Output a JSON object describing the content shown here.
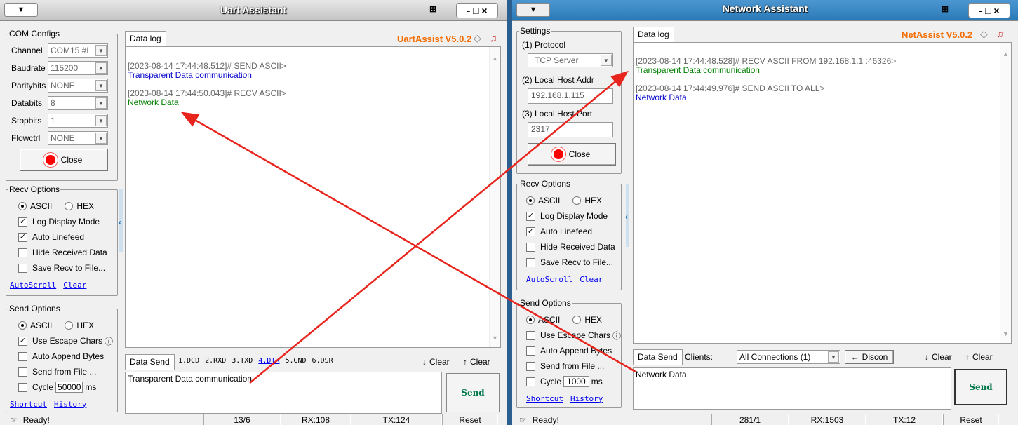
{
  "uart": {
    "title": "Uart Assistant",
    "menu": "▼",
    "window_controls": "- □ ×",
    "com_group": "COM Configs",
    "channel_label": "Channel",
    "channel_value": "COM15 #L",
    "baud_label": "Baudrate",
    "baud_value": "115200",
    "parity_label": "Paritybits",
    "parity_value": "NONE",
    "data_label": "Databits",
    "data_value": "8",
    "stop_label": "Stopbits",
    "stop_value": "1",
    "flow_label": "Flowctrl",
    "flow_value": "NONE",
    "close_label": "Close",
    "recv_group": "Recv Options",
    "ascii": "ASCII",
    "hex": "HEX",
    "log_display": "Log Display Mode",
    "auto_linefeed": "Auto Linefeed",
    "hide_recv": "Hide Received Data",
    "save_recv": "Save Recv to File...",
    "autoscroll": "AutoScroll",
    "clear": "Clear",
    "send_group": "Send Options",
    "escape": "Use Escape Chars",
    "append": "Auto Append Bytes",
    "send_file": "Send from File ...",
    "cycle": "Cycle",
    "cycle_value": "50000",
    "ms": "ms",
    "shortcut": "Shortcut",
    "history": "History",
    "datalog_tab": "Data log",
    "brand": "UartAssist V5.0.2",
    "log": [
      {
        "text": "[2023-08-14 17:44:48.512]# SEND ASCII>",
        "color": "#666"
      },
      {
        "text": "Transparent Data communication",
        "color": "#0000cc"
      },
      {
        "text": "[2023-08-14 17:44:50.043]# RECV ASCII>",
        "color": "#666"
      },
      {
        "text": "Network Data",
        "color": "#008000"
      }
    ],
    "datasend_tab": "Data Send",
    "pins": [
      "1.DCD",
      "2.RXD",
      "3.TXD",
      "4.DTR",
      "5.GND",
      "6.DSR"
    ],
    "clear_btn": "Clear",
    "clear_btn2": "Clear",
    "send_text": "Transparent Data communication",
    "send_btn": "Send",
    "status_ready": "Ready!",
    "status_count": "13/6",
    "status_rx": "RX:108",
    "status_tx": "TX:124",
    "status_reset": "Reset"
  },
  "net": {
    "title": "Network Assistant",
    "window_controls": "- □ ×",
    "settings_group": "Settings",
    "protocol_label": "(1) Protocol",
    "protocol_value": "TCP Server",
    "host_label": "(2) Local Host Addr",
    "host_value": "192.168.1.115",
    "port_label": "(3) Local Host Port",
    "port_value": "2317",
    "close_label": "Close",
    "recv_group": "Recv Options",
    "ascii": "ASCII",
    "hex": "HEX",
    "log_display": "Log Display Mode",
    "auto_linefeed": "Auto Linefeed",
    "hide_recv": "Hide Received Data",
    "save_recv": "Save Recv to File...",
    "autoscroll": "AutoScroll",
    "clear": "Clear",
    "send_group": "Send Options",
    "escape": "Use Escape Chars",
    "append": "Auto Append Bytes",
    "send_file": "Send from File ...",
    "cycle": "Cycle",
    "cycle_value": "1000",
    "ms": "ms",
    "shortcut": "Shortcut",
    "history": "History",
    "datalog_tab": "Data log",
    "brand": "NetAssist V5.0.2",
    "log": [
      {
        "text": "[2023-08-14 17:44:48.528]# RECV ASCII FROM 192.168.1.1 :46326>",
        "color": "#666"
      },
      {
        "text": "Transparent Data communication",
        "color": "#008000"
      },
      {
        "text": "[2023-08-14 17:44:49.976]# SEND ASCII TO ALL>",
        "color": "#666"
      },
      {
        "text": "Network Data",
        "color": "#0000cc"
      }
    ],
    "datasend_tab": "Data Send",
    "clients_label": "Clients:",
    "clients_value": "All Connections (1)",
    "discon": "Discon",
    "clear_btn": "Clear",
    "clear_btn2": "Clear",
    "send_text": "Network Data",
    "send_btn": "Send",
    "status_ready": "Ready!",
    "status_count": "281/1",
    "status_rx": "RX:1503",
    "status_tx": "TX:12",
    "status_reset": "Reset"
  },
  "colors": {
    "accent_orange": "#f26c00",
    "arrow_red": "#e8241c",
    "title_blue": "#2a7ab8"
  }
}
